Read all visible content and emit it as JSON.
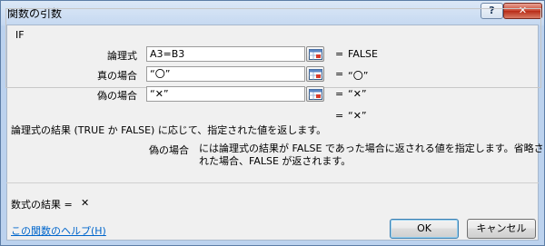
{
  "dialog": {
    "title": "関数の引数",
    "help_button": "?",
    "close_button": "✕"
  },
  "function": {
    "name": "IF",
    "arguments": [
      {
        "label": "論理式",
        "value": "A3=B3",
        "equals": "=",
        "result": "FALSE"
      },
      {
        "label": "真の場合",
        "value": "“〇”",
        "equals": "=",
        "result": "“〇”"
      },
      {
        "label": "偽の場合",
        "value": "“✕”",
        "equals": "=",
        "result": "“✕”"
      }
    ],
    "formula_equals": "=",
    "formula_result": "“✕”",
    "description": "論理式の結果 (TRUE か FALSE) に応じて、指定された値を返します。",
    "arg_desc_label": "偽の場合",
    "arg_desc_line1": "には論理式の結果が FALSE であった場合に返される値を指定します。省略さ",
    "arg_desc_line2": "れた場合、FALSE が返されます。",
    "result_label": "数式の結果 =",
    "result_value": "✕"
  },
  "footer": {
    "help_link": "この関数のヘルプ(H)",
    "ok_label": "OK",
    "cancel_label": "キャンセル"
  }
}
